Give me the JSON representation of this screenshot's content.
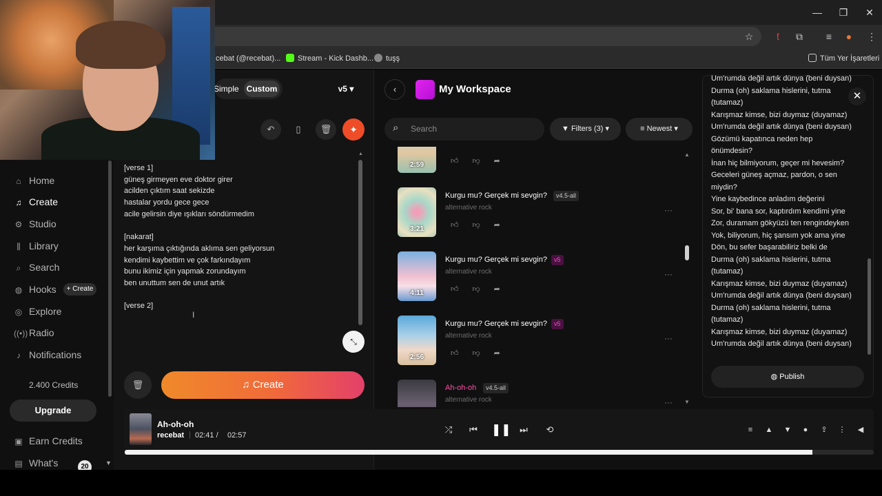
{
  "browser": {
    "window_controls": [
      "—",
      "❐",
      "✕"
    ],
    "bookmarks": [
      {
        "label": "cebat (@recebat)...",
        "color": "#3a3a3a"
      },
      {
        "label": "Stream - Kick Dashb...",
        "color": "#53fc18"
      },
      {
        "label": "tuşş",
        "color": "#888888"
      }
    ],
    "all_bookmarks": "Tüm Yer İşaretleri"
  },
  "sidebar": {
    "items": [
      {
        "label": "Home",
        "icon": "home-icon"
      },
      {
        "label": "Create",
        "icon": "create-icon",
        "active": true
      },
      {
        "label": "Studio",
        "icon": "studio-icon"
      },
      {
        "label": "Library",
        "icon": "library-icon"
      },
      {
        "label": "Search",
        "icon": "search-icon"
      },
      {
        "label": "Hooks",
        "icon": "hooks-icon"
      },
      {
        "label": "Explore",
        "icon": "explore-icon"
      },
      {
        "label": "Radio",
        "icon": "radio-icon"
      },
      {
        "label": "Notifications",
        "icon": "bell-icon"
      }
    ],
    "hooks_create": "+ Create",
    "credits": "2.400 Credits",
    "upgrade": "Upgrade",
    "earn_credits": "Earn Credits",
    "whats_new": "What's",
    "whats_new_count": "20"
  },
  "create": {
    "mode_simple": "Simple",
    "mode_custom": "Custom",
    "version": "v5",
    "lyrics": "[verse 1]\ngüneş girmeyen eve doktor girer\nacilden çıktım saat sekizde\nhastalar yordu gece gece\nacile gelirsin diye ışıkları söndürmedim\n\n[nakarat]\nher karşıma çıktığında aklıma sen geliyorsun\nkendimi kaybettim ve çok farkındayım\nbunu ikimiz için yapmak zorundayım\nben unuttum sen de unut artık\n\n[verse 2]",
    "create_button": "Create"
  },
  "workspace": {
    "title": "My Workspace",
    "search_placeholder": "Search",
    "filters": "Filters (3)",
    "sort": "Newest",
    "songs": [
      {
        "title": "",
        "tag": "",
        "genre": "",
        "duration": "2:59"
      },
      {
        "title": "Kurgu mu? Gerçek mi sevgin?",
        "tag": "v4.5-all",
        "genre": "alternative rock",
        "duration": "3:21"
      },
      {
        "title": "Kurgu mu? Gerçek mi sevgin?",
        "tag": "v5",
        "genre": "alternative rock",
        "duration": "4:11"
      },
      {
        "title": "Kurgu mu? Gerçek mi sevgin?",
        "tag": "v5",
        "genre": "alternative rock",
        "duration": "2:56"
      },
      {
        "title": "Ah-oh-oh",
        "tag": "v4.5-all",
        "genre": "alternative rock",
        "duration": ""
      }
    ]
  },
  "lyrics_panel": {
    "text": "Um'rumda değil artık dünya (beni duysan)\nDurma (oh) saklama hislerini, tutma\n(tutamaz)\nKarışmaz kimse, bizi duymaz (duyamaz)\nUm'rumda değil artık dünya (beni duysan)\nGözümü kapatınca neden hep\nönümdesin?\nİnan hiç bilmiyorum, geçer mi hevesim?\nGeceleri güneş açmaz, pardon, o sen\nmiydin?\nYine kaybedince anladım değerini\nSor, bi' bana sor, kaptırdım kendimi yine\nZor, duramam gökyüzü ten rengindeyken\nYok, biliyorum, hiç şansım yok ama yine\nDön, bu sefer başarabiliriz belki de\nDurma (oh) saklama hislerini, tutma\n(tutamaz)\nKarışmaz kimse, bizi duymaz (duyamaz)\nUm'rumda değil artık dünya (beni duysan)\nDurma (oh) saklama hislerini, tutma\n(tutamaz)\nKarışmaz kimse, bizi duymaz (duyamaz)\nUm'rumda değil artık dünya (beni duysan)",
    "publish": "Publish"
  },
  "player": {
    "title": "Ah-oh-oh",
    "artist": "recebat",
    "current_time": "02:41",
    "sep": "/",
    "total_time": "02:57",
    "progress": 0.918
  },
  "colors": {
    "accent": "#ef4c28",
    "workspace_logo": "#d81ff0",
    "pink_title": "#ff4fa8"
  }
}
